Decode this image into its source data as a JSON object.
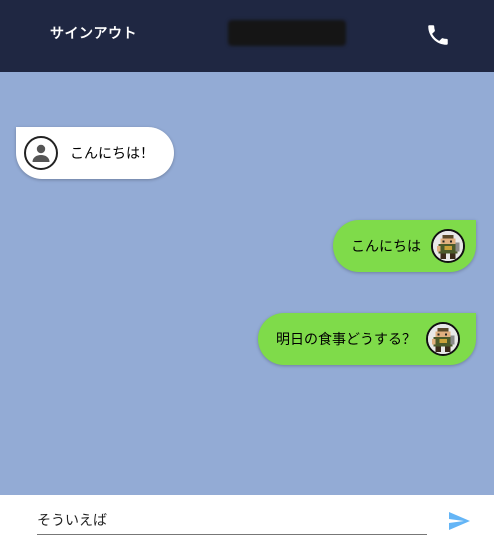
{
  "header": {
    "signout_label": "サインアウト",
    "title_redacted": true,
    "background": "#1f2742",
    "phone_icon": "phone-icon"
  },
  "messages": [
    {
      "direction": "incoming",
      "text": "こんにちは！",
      "avatar": "default-user-avatar"
    },
    {
      "direction": "outgoing",
      "text": "こんにちは",
      "avatar": "pixel-character-avatar"
    },
    {
      "direction": "outgoing",
      "text": "明日の食事どうする？",
      "avatar": "pixel-character-avatar"
    }
  ],
  "composer": {
    "input_value": "そういえば",
    "send_icon": "send-icon",
    "send_color": "#64b5f6"
  },
  "colors": {
    "chat_background": "#93abd5",
    "incoming_bubble": "#ffffff",
    "outgoing_bubble": "#7fdb4a"
  }
}
